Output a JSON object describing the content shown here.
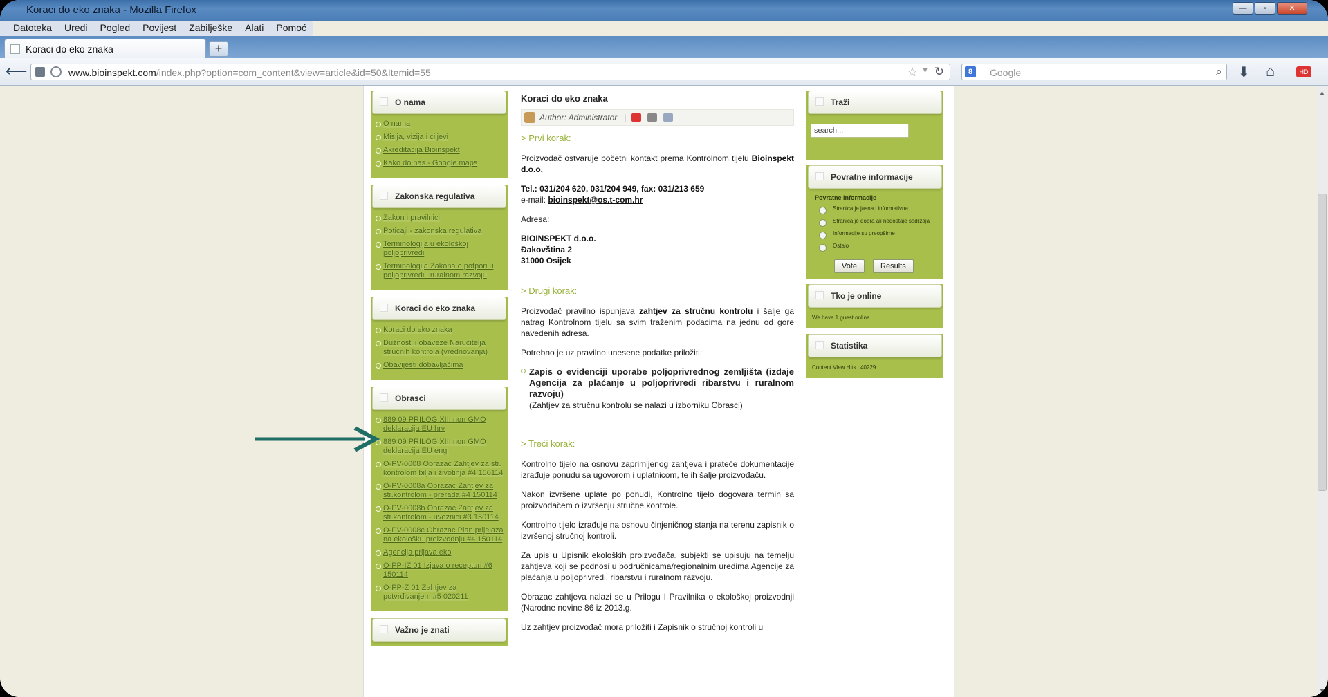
{
  "window": {
    "title": "Koraci do eko znaka - Mozilla Firefox"
  },
  "menubar": {
    "items": [
      "Datoteka",
      "Uredi",
      "Pogled",
      "Povijest",
      "Zabilješke",
      "Alati",
      "Pomoć"
    ]
  },
  "tab": {
    "label": "Koraci do eko znaka",
    "new_tab_label": "+"
  },
  "navbar": {
    "url_domain": "www.bioinspekt.com",
    "url_path": "/index.php?option=com_content&view=article&id=50&Itemid=55",
    "search_placeholder": "Google",
    "search_engine_icon": "google-icon"
  },
  "left_modules": [
    {
      "title": "O nama",
      "links": [
        "O nama",
        "Misija, vizija i ciljevi",
        "Akreditacija Bioinspekt",
        "Kako do nas - Google maps"
      ]
    },
    {
      "title": "Zakonska regulativa",
      "links": [
        "Zakon i pravilnici",
        "Poticaji - zakonska regulativa",
        "Terminologija u ekološkoj poljoprivredi",
        "Terminologija Zakona o potpori u poljoprivredi i ruralnom razvoju"
      ]
    },
    {
      "title": "Koraci do eko znaka",
      "links": [
        "Koraci do eko znaka",
        "Dužnosti i obaveze Naručitelja stručnih kontrola (vrednovanja)",
        "Obavijesti dobavljačima"
      ]
    },
    {
      "title": "Obrasci",
      "links": [
        "889 09 PRILOG XIII non GMO deklaracija EU hrv",
        "889 09 PRILOG XIII non GMO deklaracija EU engl",
        "O-PV-0008 Obrazac Zahtjev za str. kontrolom bilja i životinja #4 150114",
        "O-PV-0008a Obrazac Zahtjev za str.kontrolom - prerada #4 150114",
        "O-PV-0008b Obrazac Zahtjev za str.kontrolom - uvoznici #3 150114",
        "O-PV-0008c Obrazac Plan prijelaza na ekološku proizvodnju #4 150114",
        "Agencija prijava eko",
        "O-PP-IZ 01 Izjava o recepturi #6 150114",
        "O-PP-Z 01 Zahtjev za potvrđivanjem #5 020211"
      ]
    },
    {
      "title": "Važno je znati",
      "links": []
    }
  ],
  "article": {
    "title": "Koraci do eko znaka",
    "author": "Author: Administrator",
    "step1": "> Prvi korak:",
    "p1_text": "Proizvođač ostvaruje početni kontakt prema Kontrolnom tijelu",
    "p1_bold": "Bioinspekt d.o.o.",
    "tel": "Tel.: 031/204 620, 031/204 949, fax: 031/213 659",
    "email_label": "e-mail:",
    "email": "bioinspekt@os.t-com.hr",
    "address_label": "Adresa:",
    "address_line1": "BIOINSPEKT d.o.o.",
    "address_line2": "Đakovština 2",
    "address_line3": "31000 Osijek",
    "step2": "> Drugi korak:",
    "p2_before": "Proizvođač pravilno ispunjava",
    "p2_bold": "zahtjev za stručnu kontrolu",
    "p2_after": "i šalje ga natrag Kontrolnom tijelu sa svim traženim podacima na jednu od gore navedenih adresa.",
    "p3": "Potrebno je uz pravilno unesene podatke priložiti:",
    "zapis_bold": "Zapis o evidenciji uporabe poljoprivrednog zemljišta (izdaje Agencija za plaćanje u poljoprivredi ribarstvu i ruralnom razvoju)",
    "zapis_note": "(Zahtjev za stručnu kontrolu se nalazi u izborniku Obrasci)",
    "step3": "> Treći korak:",
    "p4": "Kontrolno tijelo  na osnovu zaprimljenog zahtjeva i prateće dokumentacije izrađuje ponudu sa ugovorom i uplatnicom, te ih šalje proizvođaču.",
    "p5": "Nakon izvršene uplate po ponudi, Kontrolno tijelo dogovara termin sa proizvođačem  o izvršenju stručne kontrole.",
    "p6": "Kontrolno tijelo izrađuje na osnovu činjeničnog stanja na terenu zapisnik o izvršenoj stručnoj kontroli.",
    "p7": "Za upis u Upisnik ekoloških proizvođača, subjekti se upisuju na temelju zahtjeva koji se podnosi u područnicama/regionalnim uredima Agencije za plaćanja u poljoprivredi, ribarstvu i ruralnom razvoju.",
    "p8": "Obrazac zahtjeva nalazi se u Prilogu I Pravilnika o ekološkoj proizvodnji (Narodne novine 86 iz 2013.g.",
    "p9": "Uz zahtjev proizvođač mora priložiti i Zapisnik o  stručnoj kontroli u"
  },
  "right_modules": {
    "search": {
      "title": "Traži",
      "placeholder": "search..."
    },
    "poll": {
      "title": "Povratne informacije",
      "question": "Povratne informacije",
      "options": [
        "Stranica je jasna i informativna",
        "Stranica je dobra ali nedostaje sadržaja",
        "Informacije su preopširne",
        "Ostalo"
      ],
      "vote_label": "Vote",
      "results_label": "Results"
    },
    "online": {
      "title": "Tko je online",
      "text": "We have 1 guest online"
    },
    "stats": {
      "title": "Statistika",
      "text": "Content View Hits : 40229"
    }
  },
  "annotation": {
    "arrow_color": "#1f6e66"
  }
}
